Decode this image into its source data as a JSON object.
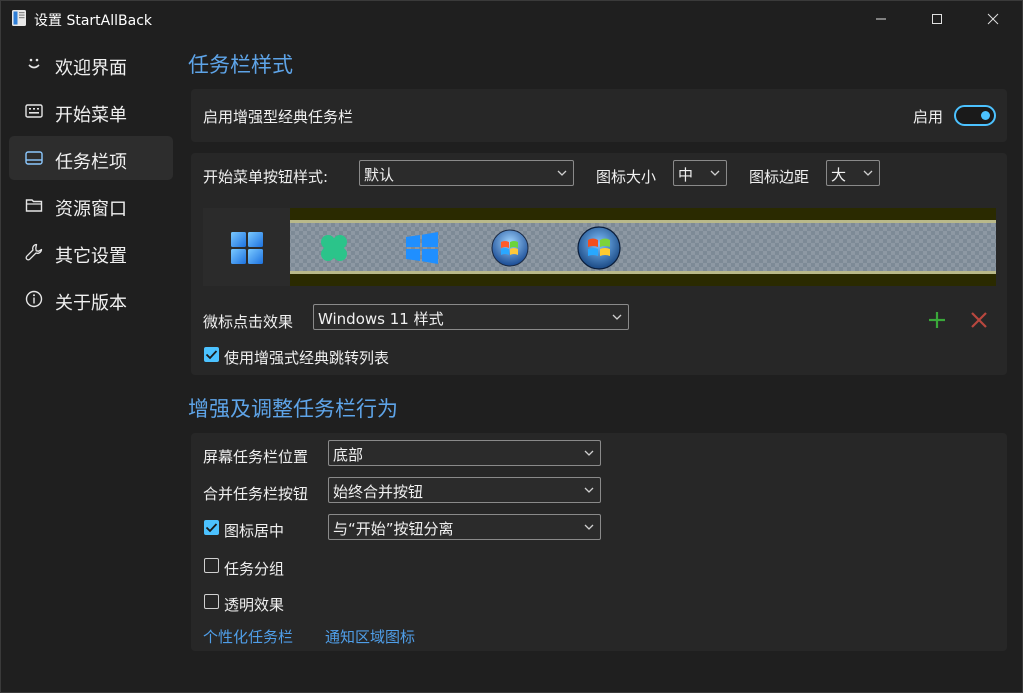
{
  "window": {
    "title": "设置 StartAllBack"
  },
  "sidebar": {
    "items": [
      {
        "label": "欢迎界面",
        "icon": "smiley-icon"
      },
      {
        "label": "开始菜单",
        "icon": "keyboard-icon"
      },
      {
        "label": "任务栏项",
        "icon": "taskbar-icon",
        "active": true
      },
      {
        "label": "资源窗口",
        "icon": "folder-icon"
      },
      {
        "label": "其它设置",
        "icon": "wrench-icon"
      },
      {
        "label": "关于版本",
        "icon": "info-icon"
      }
    ]
  },
  "taskbar_style": {
    "title": "任务栏样式",
    "enhanced_label": "启用增强型经典任务栏",
    "enable_label": "启用",
    "enabled": true,
    "start_button_label": "开始菜单按钮样式:",
    "start_button_value": "默认",
    "icon_size_label": "图标大小",
    "icon_size_value": "中",
    "icon_margin_label": "图标边距",
    "icon_margin_value": "大",
    "click_effect_label": "微标点击效果",
    "click_effect_value": "Windows 11 样式",
    "jumplist_label": "使用增强式经典跳转列表",
    "jumplist_checked": true
  },
  "behavior": {
    "title": "增强及调整任务栏行为",
    "position_label": "屏幕任务栏位置",
    "position_value": "底部",
    "combine_label": "合并任务栏按钮",
    "combine_value": "始终合并按钮",
    "center_label": "图标居中",
    "center_checked": true,
    "center_value": "与“开始”按钮分离",
    "group_label": "任务分组",
    "group_checked": false,
    "transparent_label": "透明效果",
    "transparent_checked": false,
    "link_personalize": "个性化任务栏",
    "link_notify": "通知区域图标"
  },
  "colors": {
    "accent": "#4cc2ff",
    "section_title": "#5ea4e8",
    "link": "#4f9ee8",
    "add": "#3aa83a",
    "remove": "#b8473e"
  }
}
